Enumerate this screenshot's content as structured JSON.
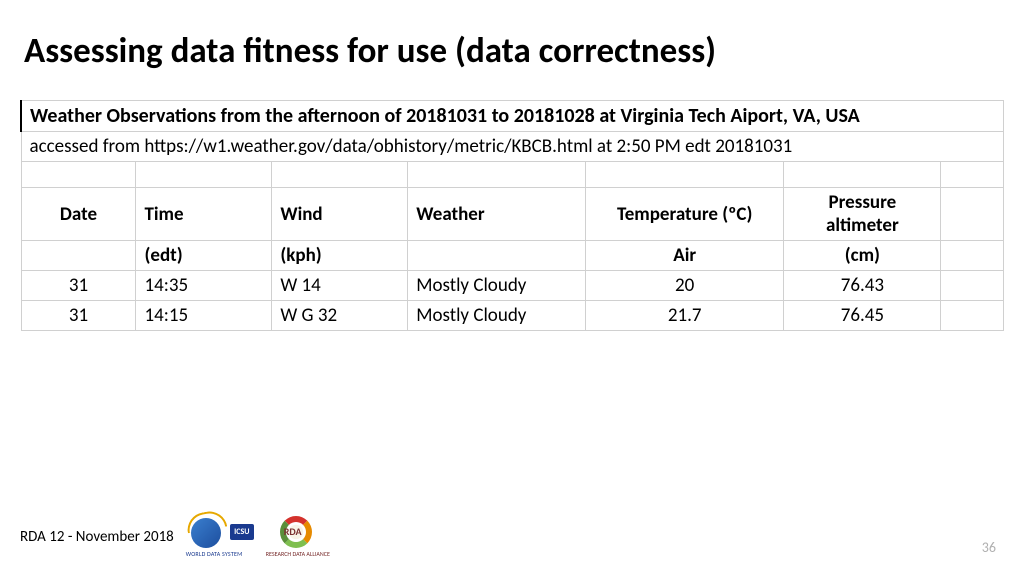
{
  "title": "Assessing data fitness for use (data correctness)",
  "table": {
    "caption": "Weather Observations from the afternoon of 20181031 to 20181028 at Virginia Tech Aiport, VA, USA",
    "access": "accessed from https://w1.weather.gov/data/obhistory/metric/KBCB.html at 2:50 PM edt 20181031",
    "headers": {
      "date": "Date",
      "time": "Time",
      "time_unit": "(edt)",
      "wind": "Wind",
      "wind_unit": "(kph)",
      "weather": "Weather",
      "temp": "Temperature (ºC)",
      "temp_sub": "Air",
      "press": "Pressure altimeter",
      "press_unit": "(cm)"
    },
    "rows": [
      {
        "date": "31",
        "time": "14:35",
        "wind": "W 14",
        "weather": "Mostly Cloudy",
        "temp": "20",
        "press": "76.43"
      },
      {
        "date": "31",
        "time": "14:15",
        "wind": "W G 32",
        "weather": "Mostly Cloudy",
        "temp": "21.7",
        "press": "76.45"
      }
    ]
  },
  "footer": {
    "text": "RDA 12 - November 2018",
    "logo1_badge": "ICSU",
    "logo1_text": "WORLD DATA SYSTEM",
    "logo2_badge": "RDA",
    "logo2_text": "RESEARCH DATA ALLIANCE"
  },
  "pagenum": "36"
}
